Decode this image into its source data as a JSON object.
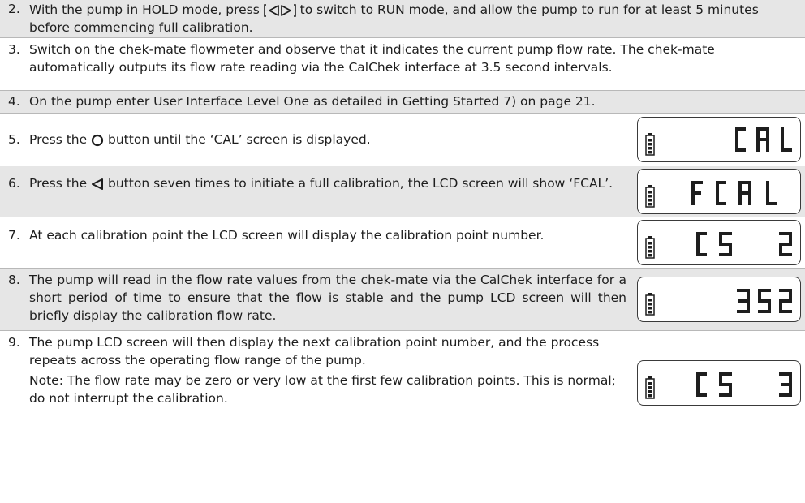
{
  "steps": [
    {
      "num": "2.",
      "text_a": "With the pump in HOLD mode, press ",
      "button": "[◁▷]",
      "text_b": " to switch to RUN mode, and allow the pump to run for at least 5 minutes before commencing full calibration."
    },
    {
      "num": "3.",
      "text": "Switch on the chek-mate flowmeter and observe that it indicates the current pump flow rate. The chek-mate automatically outputs its flow rate reading via the CalChek interface at 3.5 second intervals."
    },
    {
      "num": "4.",
      "text": "On the pump enter User Interface Level One as detailed in Getting Started 7) on page 21."
    },
    {
      "num": "5.",
      "text_a": "Press the ",
      "text_b": " button until the ‘CAL’ screen is displayed.",
      "lcd": "CAL"
    },
    {
      "num": "6.",
      "text_a": "Press the ",
      "text_b": " button seven times to initiate a full calibration, the LCD screen will show ‘FCAL’.",
      "lcd": "FCAL"
    },
    {
      "num": "7.",
      "text": "At each calibration point the LCD screen will display the calibration point number.",
      "lcd": "CS 2"
    },
    {
      "num": "8.",
      "text": "The pump will read in the flow rate values from the chek-mate via the CalChek interface for a short period of time to ensure that the flow is stable and the pump LCD screen will then briefly display the calibration flow rate.",
      "lcd": "352"
    },
    {
      "num": "9.",
      "text": "The pump LCD screen will then display the next calibration point number, and the process repeats across the operating flow range of the pump.",
      "note": "Note: The flow rate may be zero or very low at the first few calibration points. This is normal; do not interrupt the calibration.",
      "lcd": "CS 3"
    }
  ]
}
